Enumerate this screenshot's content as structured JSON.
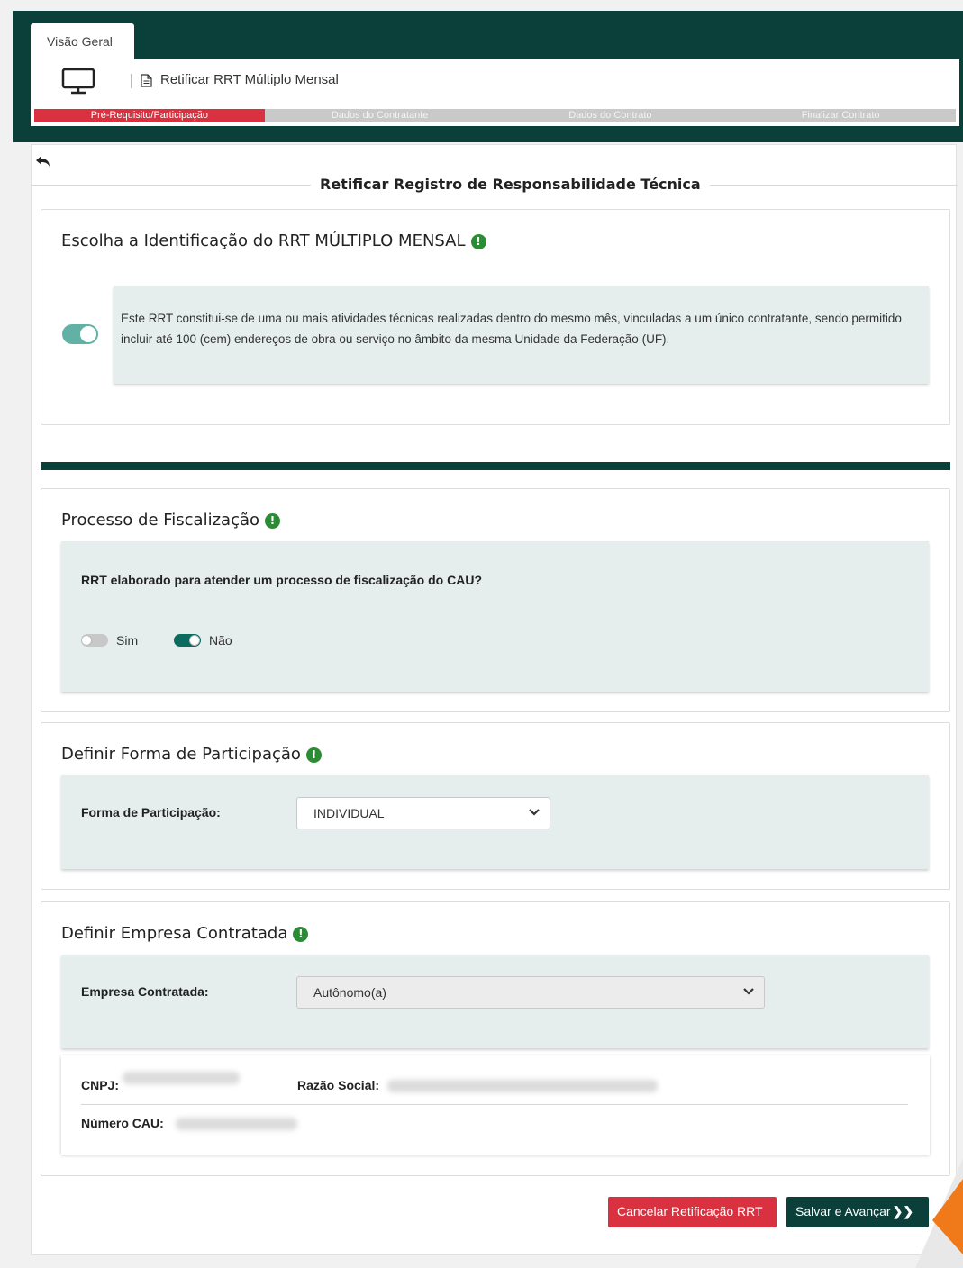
{
  "header": {
    "tab_label": "Visão Geral",
    "title": "Retificar RRT Múltiplo Mensal",
    "steps": [
      {
        "label": "Pré-Requisito/Participação",
        "active": true
      },
      {
        "label": "Dados do Contratante",
        "active": false
      },
      {
        "label": "Dados do Contrato",
        "active": false
      },
      {
        "label": "Finalizar Contrato",
        "active": false
      }
    ],
    "accent_color": "#0b3f3a",
    "active_step_color": "#d9313f"
  },
  "main": {
    "title": "Retificar Registro de Responsabilidade Técnica"
  },
  "identificacao": {
    "title": "Escolha a Identificação do RRT MÚLTIPLO MENSAL",
    "description": "Este RRT constitui-se de uma ou mais atividades técnicas realizadas dentro do mesmo mês, vinculadas a um único contratante, sendo permitido incluir até 100 (cem) endereços de obra ou serviço no âmbito da mesma Unidade da Federação (UF).",
    "toggle_on": true
  },
  "fiscalizacao": {
    "title": "Processo de Fiscalização",
    "question": "RRT elaborado para atender um processo de fiscalização do CAU?",
    "option_sim": "Sim",
    "option_nao": "Não",
    "selected": "Não"
  },
  "participacao": {
    "title": "Definir Forma de Participação",
    "label": "Forma de Participação:",
    "value": "INDIVIDUAL"
  },
  "empresa": {
    "title": "Definir Empresa Contratada",
    "label": "Empresa Contratada:",
    "value": "Autônomo(a)",
    "cnpj_label": "CNPJ:",
    "razao_label": "Razão Social:",
    "cau_label": "Número CAU:"
  },
  "buttons": {
    "cancel": "Cancelar Retificação RRT",
    "save": "Salvar e Avançar",
    "save_arrows": "❯❯"
  },
  "icons": [
    "monitor-icon",
    "document-icon",
    "back-arrow-icon",
    "info-icon",
    "chevron-down-icon"
  ]
}
